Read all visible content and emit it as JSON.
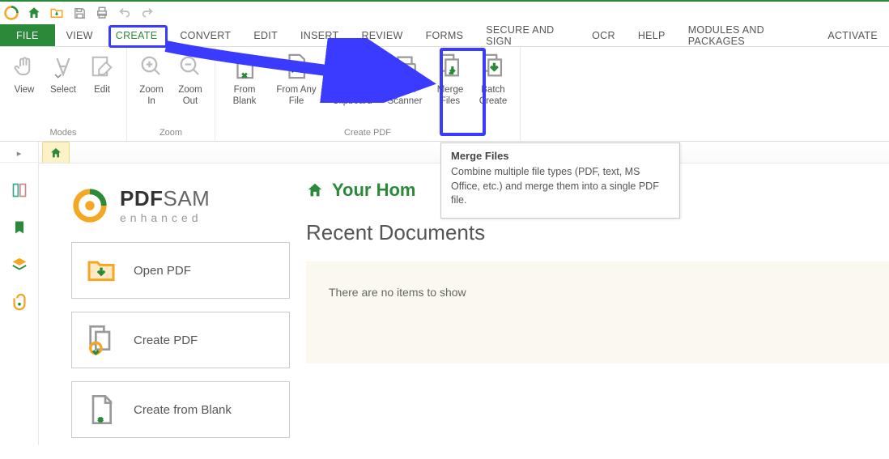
{
  "menubar": {
    "items": [
      "FILE",
      "VIEW",
      "CREATE",
      "CONVERT",
      "EDIT",
      "INSERT",
      "REVIEW",
      "FORMS",
      "SECURE AND SIGN",
      "OCR",
      "HELP",
      "MODULES AND PACKAGES",
      "ACTIVATE"
    ]
  },
  "ribbon": {
    "groups": {
      "modes": {
        "label": "Modes",
        "buttons": [
          "View",
          "Select",
          "Edit"
        ]
      },
      "zoom": {
        "label": "Zoom",
        "buttons": [
          "Zoom\nIn",
          "Zoom\nOut"
        ]
      },
      "create_pdf": {
        "label": "Create PDF",
        "buttons": [
          "From\nBlank",
          "From Any\nFile",
          "From\nClipboard",
          "From\nScanner",
          "Merge\nFiles",
          "Batch\nCreate"
        ]
      }
    }
  },
  "tooltip": {
    "title": "Merge Files",
    "body": "Combine multiple file types (PDF, text, MS Office, etc.) and merge them into a single PDF file."
  },
  "brand": {
    "line1a": "PDF",
    "line1b": "SAM",
    "line2": "enhanced"
  },
  "actions": {
    "open": "Open PDF",
    "create": "Create PDF",
    "blank": "Create from Blank"
  },
  "home": {
    "title": "Your Hom",
    "recent_heading": "Recent Documents",
    "recent_empty": "There are no items to show"
  }
}
